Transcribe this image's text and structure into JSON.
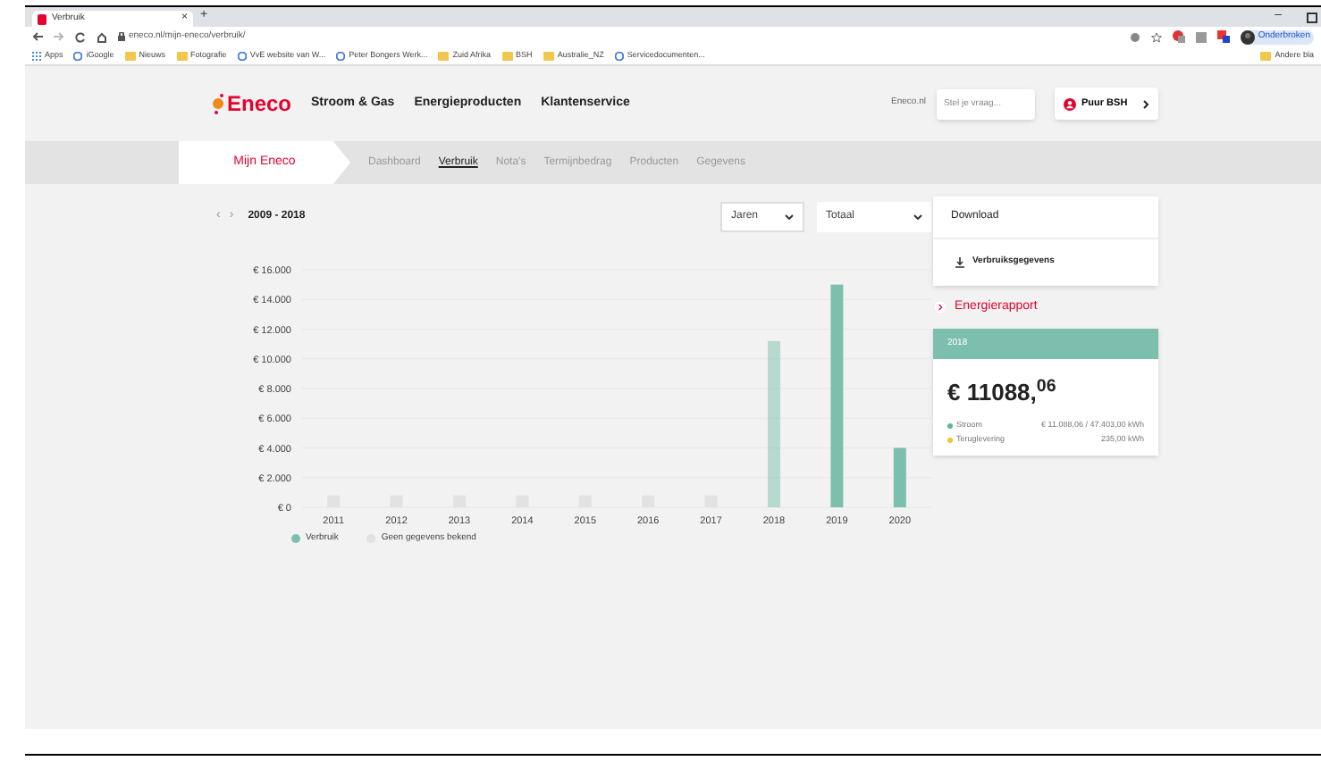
{
  "browser": {
    "tab": {
      "title": "Verbruik",
      "close": "×"
    },
    "new_tab": "+",
    "window_minimize": "–",
    "url": "eneco.nl/mijn-eneco/verbruik/",
    "profile": "Onderbroken",
    "bookmarks": [
      {
        "label": "Apps",
        "kind": "apps"
      },
      {
        "label": "iGoogle",
        "kind": "site"
      },
      {
        "label": "Nieuws",
        "kind": "folder"
      },
      {
        "label": "Fotografie",
        "kind": "folder"
      },
      {
        "label": "VvE website van W...",
        "kind": "site"
      },
      {
        "label": "Peter Bongers Werk...",
        "kind": "site"
      },
      {
        "label": "Zuid Afrika",
        "kind": "folder"
      },
      {
        "label": "BSH",
        "kind": "folder"
      },
      {
        "label": "Australie_NZ",
        "kind": "folder"
      },
      {
        "label": "Servicedocumenten...",
        "kind": "site"
      }
    ],
    "other_bookmarks": "Andere bla"
  },
  "header": {
    "logo": "Eneco",
    "nav": [
      "Stroom & Gas",
      "Energieproducten",
      "Klantenservice"
    ],
    "search_label": "Eneco.nl",
    "search": {
      "placeholder": "Stel je vraag..."
    },
    "account_button": "Puur BSH"
  },
  "subnav": {
    "home": "Mijn Eneco",
    "tabs": [
      {
        "label": "Dashboard",
        "selected": false
      },
      {
        "label": "Verbruik",
        "selected": true
      },
      {
        "label": "Nota's",
        "selected": false
      },
      {
        "label": "Termijnbedrag",
        "selected": false
      },
      {
        "label": "Producten",
        "selected": false
      },
      {
        "label": "Gegevens",
        "selected": false
      }
    ]
  },
  "chart_panel": {
    "prev": "‹",
    "next": "›",
    "range": "2009 - 2018",
    "period_select": "Jaren",
    "type_select": "Totaal",
    "selected_category": "2018",
    "chart_data": {
      "type": "bar",
      "categories": [
        "2011",
        "2012",
        "2013",
        "2014",
        "2015",
        "2016",
        "2017",
        "2018",
        "2019",
        "2020"
      ],
      "series": [
        {
          "name": "Verbruik",
          "color": "#7dbfae",
          "values": [
            null,
            null,
            null,
            null,
            null,
            null,
            null,
            11200,
            15000,
            4000
          ]
        },
        {
          "name": "Geen gegevens bekend",
          "color": "#e2e2e2",
          "values": [
            800,
            800,
            800,
            800,
            800,
            800,
            800,
            null,
            null,
            null
          ]
        }
      ],
      "grid": true,
      "ylim": [
        0,
        16000
      ],
      "yticks": [
        {
          "value": 0,
          "label": "€ 0"
        },
        {
          "value": 2000,
          "label": "€ 2.000"
        },
        {
          "value": 4000,
          "label": "€ 4.000"
        },
        {
          "value": 6000,
          "label": "€ 6.000"
        },
        {
          "value": 8000,
          "label": "€ 8.000"
        },
        {
          "value": 10000,
          "label": "€ 10.000"
        },
        {
          "value": 12000,
          "label": "€ 12.000"
        },
        {
          "value": 14000,
          "label": "€ 14.000"
        },
        {
          "value": 16000,
          "label": "€ 16.000"
        }
      ]
    }
  },
  "download_card": {
    "title": "Download",
    "link": "Verbruiksgegevens"
  },
  "report_link": "Energierapport",
  "summary_card": {
    "year": "2018",
    "amount": "€ 11088,$^{06}$",
    "rows": [
      {
        "label": "Stroom",
        "value": "€ 11.088,06 / 47.403,00 kWh",
        "color": "#5cb88a"
      },
      {
        "label": "Teruglevering",
        "value": "235,00 kWh",
        "color": "#f0c330"
      }
    ]
  }
}
